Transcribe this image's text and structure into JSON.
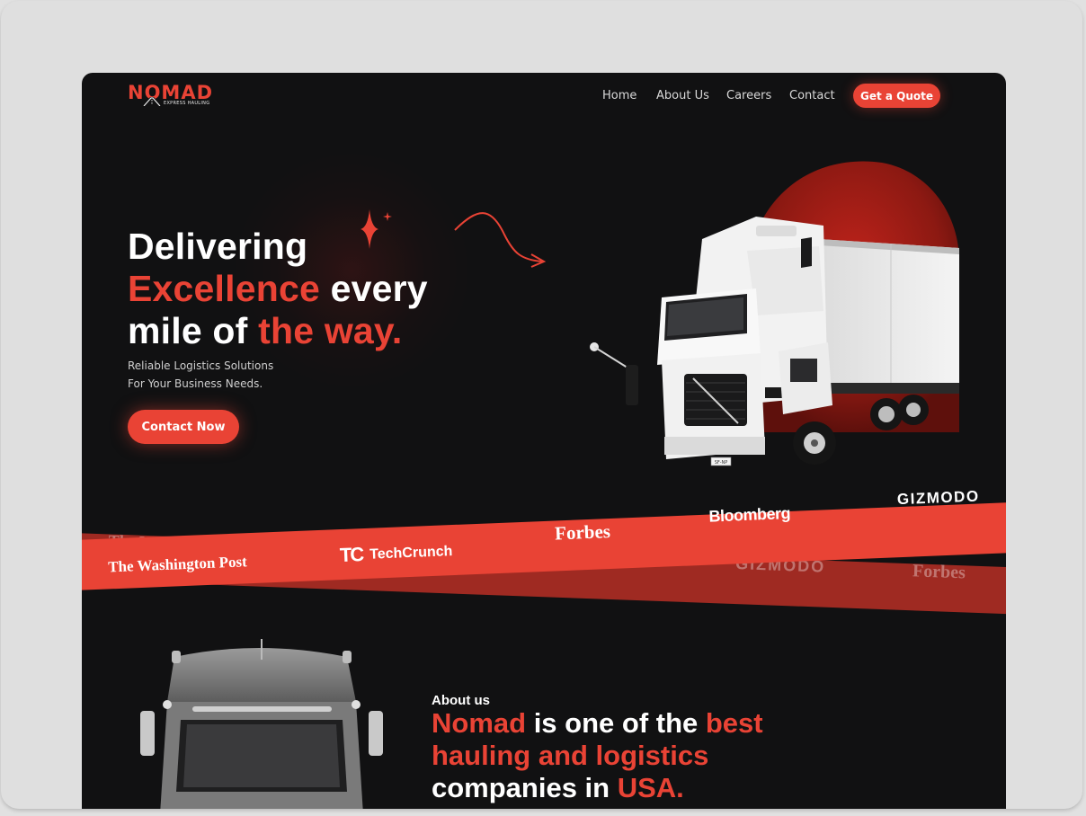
{
  "brand": {
    "name": "NOMAD",
    "tagline": "EXPRESS HAULING"
  },
  "nav": {
    "items": [
      "Home",
      "About Us",
      "Careers",
      "Contact"
    ],
    "cta": "Get a Quote"
  },
  "hero": {
    "line1": "Delivering",
    "line2_red": "Excellence",
    "line2_white": " every",
    "line3_white": "mile of ",
    "line3_red": "the way.",
    "subtitle_line1": "Reliable Logistics Solutions",
    "subtitle_line2": "For Your Business Needs.",
    "cta": "Contact Now"
  },
  "press": {
    "front": [
      "The Washington Post",
      "TechCrunch",
      "Forbes",
      "Bloomberg",
      "GIZMODO"
    ],
    "back": [
      "The Washington Post",
      "GIZMODO",
      "Forbes"
    ]
  },
  "truck_plate": "SF-NP",
  "about": {
    "label": "About us",
    "title_red1": "Nomad",
    "title_white1": " is one of the ",
    "title_red2": "best",
    "title_red3": "hauling and logistics",
    "title_white2": "companies in ",
    "title_red4": "USA."
  },
  "colors": {
    "accent": "#e94335",
    "background": "#111112"
  }
}
